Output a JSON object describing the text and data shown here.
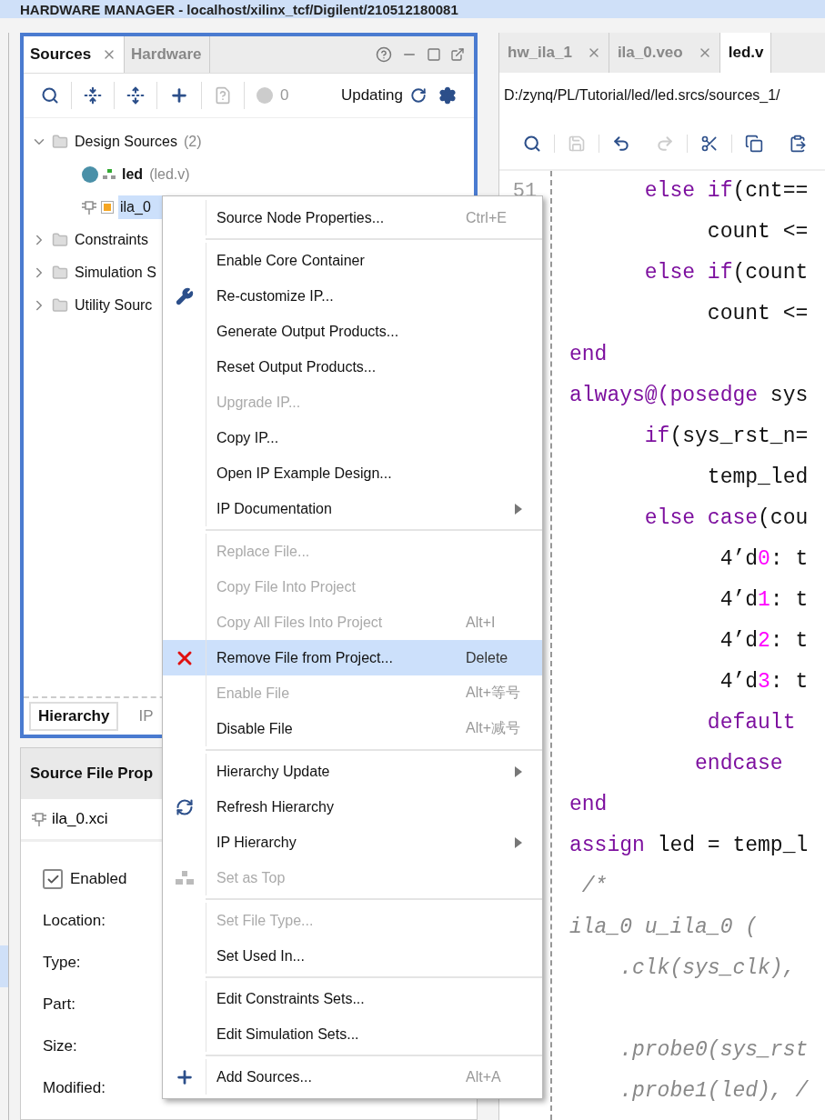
{
  "title_bar": {
    "text": "HARDWARE MANAGER - localhost/xilinx_tcf/Digilent/210512180081"
  },
  "sources_panel": {
    "tabs": [
      {
        "label": "Sources",
        "selected": true,
        "closable": true
      },
      {
        "label": "Hardware",
        "selected": false,
        "closable": false
      }
    ],
    "toolbar": {
      "badge_count": "0",
      "status": "Updating"
    },
    "tree": [
      {
        "kind": "folder",
        "label": "Design Sources",
        "count": "(2)",
        "expanded": true,
        "children": [
          {
            "kind": "top",
            "label": "led",
            "file": "(led.v)",
            "selected": false
          },
          {
            "kind": "ip",
            "label": "ila_0",
            "selected": true
          }
        ]
      },
      {
        "kind": "folder",
        "label": "Constraints",
        "expanded": false
      },
      {
        "kind": "folder",
        "label": "Simulation S",
        "expanded": false
      },
      {
        "kind": "folder",
        "label": "Utility Sourc",
        "expanded": false
      }
    ],
    "bottom_tabs": [
      {
        "label": "Hierarchy",
        "selected": true
      },
      {
        "label": "IP",
        "selected": false
      }
    ]
  },
  "properties_panel": {
    "title": "Source File Prop",
    "file": "ila_0.xci",
    "enabled": {
      "label": "Enabled",
      "checked": true
    },
    "fields": [
      "Location:",
      "Type:",
      "Part:",
      "Size:",
      "Modified:"
    ]
  },
  "editor": {
    "tabs": [
      {
        "label": "hw_ila_1",
        "selected": false
      },
      {
        "label": "ila_0.veo",
        "selected": false
      },
      {
        "label": "led.v",
        "selected": true
      }
    ],
    "path": "D:/zynq/PL/Tutorial/led/led.srcs/sources_1/",
    "line_numbers": [
      "51"
    ],
    "lines": [
      [
        {
          "text": "      else if",
          "kind": "keyword"
        },
        {
          "text": "(cnt==",
          "kind": "plain"
        }
      ],
      [
        {
          "text": "           count <=",
          "kind": "plain"
        }
      ],
      [
        {
          "text": "      else if",
          "kind": "keyword"
        },
        {
          "text": "(count",
          "kind": "plain"
        }
      ],
      [
        {
          "text": "           count <=",
          "kind": "plain"
        }
      ],
      [
        {
          "text": "end",
          "kind": "keyword"
        }
      ],
      [
        {
          "text": "always@(posedge",
          "kind": "keyword"
        },
        {
          "text": " sys",
          "kind": "plain"
        }
      ],
      [
        {
          "text": "      if",
          "kind": "keyword"
        },
        {
          "text": "(sys_rst_n=",
          "kind": "plain"
        }
      ],
      [
        {
          "text": "           temp_led",
          "kind": "plain"
        }
      ],
      [
        {
          "text": "      else case",
          "kind": "keyword"
        },
        {
          "text": "(cou",
          "kind": "plain"
        }
      ],
      [
        {
          "text": "            4’d",
          "kind": "plain"
        },
        {
          "text": "0",
          "kind": "number"
        },
        {
          "text": ": t",
          "kind": "plain"
        }
      ],
      [
        {
          "text": "            4’d",
          "kind": "plain"
        },
        {
          "text": "1",
          "kind": "number"
        },
        {
          "text": ": t",
          "kind": "plain"
        }
      ],
      [
        {
          "text": "            4’d",
          "kind": "plain"
        },
        {
          "text": "2",
          "kind": "number"
        },
        {
          "text": ": t",
          "kind": "plain"
        }
      ],
      [
        {
          "text": "            4’d",
          "kind": "plain"
        },
        {
          "text": "3",
          "kind": "number"
        },
        {
          "text": ": t",
          "kind": "plain"
        }
      ],
      [
        {
          "text": "           default",
          "kind": "keyword"
        }
      ],
      [
        {
          "text": "          endcase",
          "kind": "keyword"
        }
      ],
      [
        {
          "text": "end",
          "kind": "keyword"
        }
      ],
      [
        {
          "text": "assign",
          "kind": "keyword"
        },
        {
          "text": " led = temp_l",
          "kind": "plain"
        }
      ],
      [
        {
          "text": " /*",
          "kind": "comment"
        }
      ],
      [
        {
          "text": "ila_0 u_ila_0 (",
          "kind": "comment"
        }
      ],
      [
        {
          "text": "    .clk(sys_clk),",
          "kind": "comment"
        }
      ],
      {
        "blank_before": true,
        "tokens": [
          {
            "text": "    .probe0(sys_rst",
            "kind": "comment"
          }
        ]
      },
      [
        {
          "text": "    .probe1(led), /",
          "kind": "comment"
        }
      ]
    ]
  },
  "context_menu": {
    "items": [
      {
        "kind": "item",
        "label": "Source Node Properties...",
        "shortcut": "Ctrl+E",
        "disabled": false,
        "selected": false,
        "submenu": false
      },
      {
        "kind": "separator"
      },
      {
        "kind": "item",
        "label": "Enable Core Container",
        "disabled": false,
        "selected": false,
        "submenu": false
      },
      {
        "kind": "item",
        "label": "Re-customize IP...",
        "disabled": false,
        "selected": false,
        "submenu": false
      },
      {
        "kind": "item",
        "label": "Generate Output Products...",
        "disabled": false,
        "selected": false,
        "submenu": false
      },
      {
        "kind": "item",
        "label": "Reset Output Products...",
        "disabled": false,
        "selected": false,
        "submenu": false
      },
      {
        "kind": "item",
        "label": "Upgrade IP...",
        "disabled": true,
        "selected": false,
        "submenu": false
      },
      {
        "kind": "item",
        "label": "Copy IP...",
        "disabled": false,
        "selected": false,
        "submenu": false
      },
      {
        "kind": "item",
        "label": "Open IP Example Design...",
        "disabled": false,
        "selected": false,
        "submenu": false
      },
      {
        "kind": "item",
        "label": "IP Documentation",
        "disabled": false,
        "selected": false,
        "submenu": true
      },
      {
        "kind": "separator"
      },
      {
        "kind": "item",
        "label": "Replace File...",
        "disabled": true,
        "selected": false,
        "submenu": false
      },
      {
        "kind": "item",
        "label": "Copy File Into Project",
        "disabled": true,
        "selected": false,
        "submenu": false
      },
      {
        "kind": "item",
        "label": "Copy All Files Into Project",
        "shortcut": "Alt+I",
        "disabled": true,
        "selected": false,
        "submenu": false
      },
      {
        "kind": "item",
        "label": "Remove File from Project...",
        "shortcut": "Delete",
        "disabled": false,
        "selected": true,
        "submenu": false
      },
      {
        "kind": "item",
        "label": "Enable File",
        "shortcut": "Alt+等号",
        "disabled": true,
        "selected": false,
        "submenu": false
      },
      {
        "kind": "item",
        "label": "Disable File",
        "shortcut": "Alt+减号",
        "disabled": false,
        "selected": false,
        "submenu": false
      },
      {
        "kind": "separator"
      },
      {
        "kind": "item",
        "label": "Hierarchy Update",
        "disabled": false,
        "selected": false,
        "submenu": true
      },
      {
        "kind": "item",
        "label": "Refresh Hierarchy",
        "disabled": false,
        "selected": false,
        "submenu": false
      },
      {
        "kind": "item",
        "label": "IP Hierarchy",
        "disabled": false,
        "selected": false,
        "submenu": true
      },
      {
        "kind": "item",
        "label": "Set as Top",
        "disabled": true,
        "selected": false,
        "submenu": false
      },
      {
        "kind": "separator"
      },
      {
        "kind": "item",
        "label": "Set File Type...",
        "disabled": true,
        "selected": false,
        "submenu": false
      },
      {
        "kind": "item",
        "label": "Set Used In...",
        "disabled": false,
        "selected": false,
        "submenu": false
      },
      {
        "kind": "separator"
      },
      {
        "kind": "item",
        "label": "Edit Constraints Sets...",
        "disabled": false,
        "selected": false,
        "submenu": false
      },
      {
        "kind": "item",
        "label": "Edit Simulation Sets...",
        "disabled": false,
        "selected": false,
        "submenu": false
      },
      {
        "kind": "separator"
      },
      {
        "kind": "item",
        "label": "Add Sources...",
        "shortcut": "Alt+A",
        "disabled": false,
        "selected": false,
        "submenu": false
      }
    ]
  }
}
